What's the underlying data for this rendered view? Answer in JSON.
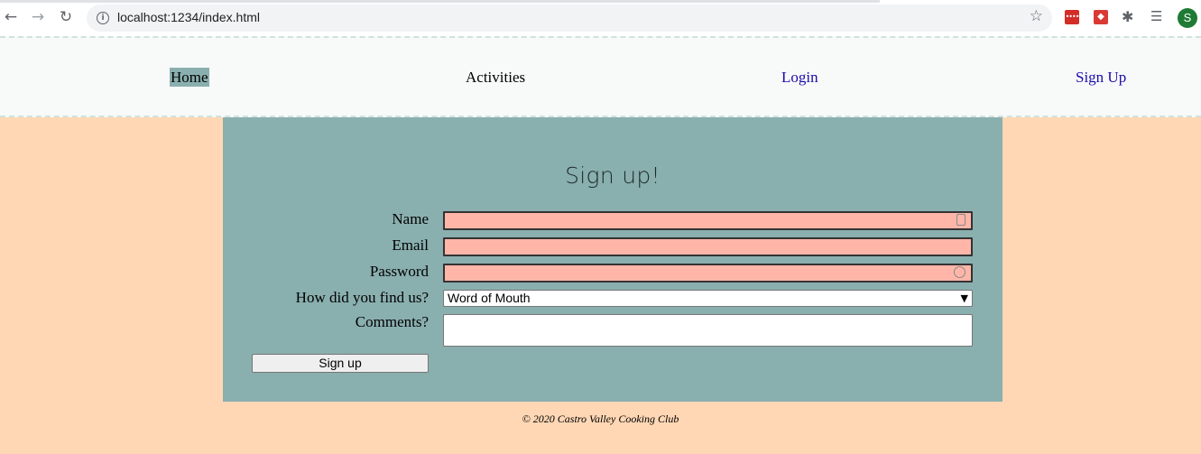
{
  "browser": {
    "url": "localhost:1234/index.html",
    "profile_initial": "S",
    "icons": [
      "back-arrow-icon",
      "forward-arrow-icon",
      "reload-icon",
      "info-icon",
      "star-icon",
      "lastpass-icon",
      "extension-red-icon",
      "puzzle-icon",
      "media-queue-icon"
    ]
  },
  "nav": {
    "home": "Home",
    "activities": "Activities",
    "login": "Login",
    "signup": "Sign Up"
  },
  "form": {
    "title": "Sign up!",
    "name_label": "Name",
    "email_label": "Email",
    "password_label": "Password",
    "source_label": "How did you find us?",
    "source_selected": "Word of Mouth",
    "comments_label": "Comments?",
    "submit_label": "Sign up"
  },
  "footer": {
    "text": "© 2020 Castro Valley Cooking Club"
  },
  "colors": {
    "page_bg": "#FFD7B5",
    "panel_bg": "#8AAFAF",
    "field_bg": "#FFB6A9",
    "header_bg": "#F8F9F9"
  }
}
